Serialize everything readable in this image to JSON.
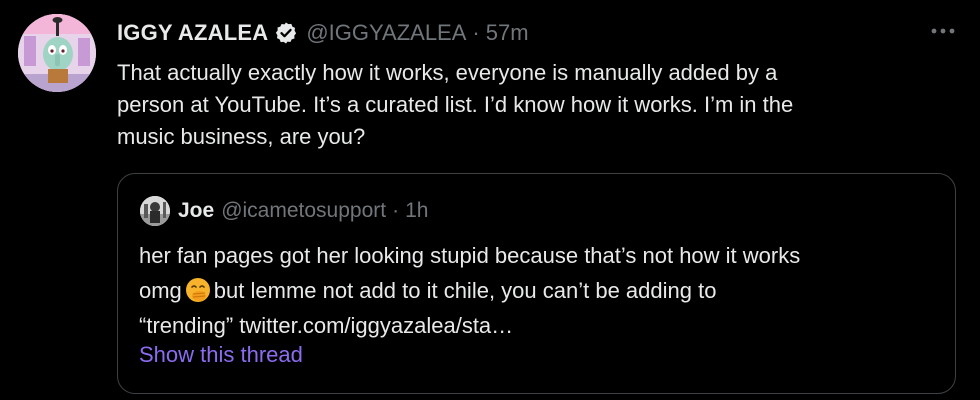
{
  "tweet": {
    "author_name": "IGGY AZALEA",
    "author_handle": "@IGGYAZALEA",
    "separator": "·",
    "time": "57m",
    "text_lines": [
      "That actually exactly how it works, everyone is manually added by a",
      "person at YouTube. It’s a curated list. I’d know how it works. I’m in the",
      "music business, are you?"
    ]
  },
  "quoted_tweet": {
    "author_name": "Joe",
    "author_handle": "@icametosupport",
    "separator": "·",
    "time": "1h",
    "line1": "her fan pages got her looking stupid because that’s not how it works",
    "line2_before_emoji": "omg",
    "line2_after_emoji": "but lemme not add to it chile, you can’t be adding to",
    "line3": "“trending” twitter.com/iggyazalea/sta…",
    "emoji": "face-with-hand-over-mouth-emoji",
    "show_thread_label": "Show this thread"
  },
  "colors": {
    "background": "#000000",
    "text": "#e7e9ea",
    "muted": "#71767b",
    "link": "#8b6cf0",
    "border": "#3e4144"
  },
  "icons": {
    "verified": "verified-badge-icon",
    "more": "more-options-icon"
  }
}
